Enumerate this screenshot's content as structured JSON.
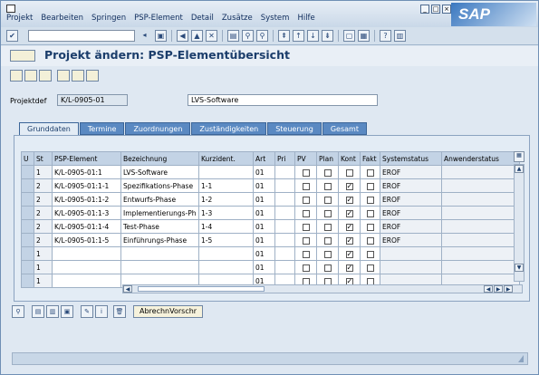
{
  "menu": [
    "Projekt",
    "Bearbeiten",
    "Springen",
    "PSP-Element",
    "Detail",
    "Zusätze",
    "System",
    "Hilfe"
  ],
  "brand": {
    "logo_text": "SAP"
  },
  "title": "Projekt ändern: PSP-Elementübersicht",
  "header": {
    "projektdef_label": "Projektdef",
    "projektdef_value": "K/L-0905-01",
    "projekt_text": "LVS-Software"
  },
  "tabs": [
    "Grunddaten",
    "Termine",
    "Zuordnungen",
    "Zuständigkeiten",
    "Steuerung",
    "Gesamt"
  ],
  "table": {
    "columns": [
      "U",
      "St",
      "PSP-Element",
      "Bezeichnung",
      "Kurzident.",
      "Art",
      "Pri",
      "PV",
      "Plan",
      "Kont",
      "Fakt",
      "Systemstatus",
      "Anwenderstatus"
    ],
    "rows": [
      {
        "st": "1",
        "psp": "K/L-0905-01:1",
        "bez": "LVS-Software",
        "kurz": "",
        "art": "01",
        "pri": "",
        "pv": false,
        "plan": false,
        "kont": false,
        "fakt": false,
        "sys": "EROF",
        "anw": ""
      },
      {
        "st": "2",
        "psp": "K/L-0905-01:1-1",
        "bez": "Spezifikations-Phase",
        "kurz": "1-1",
        "art": "01",
        "pri": "",
        "pv": false,
        "plan": false,
        "kont": true,
        "fakt": false,
        "sys": "EROF",
        "anw": ""
      },
      {
        "st": "2",
        "psp": "K/L-0905-01:1-2",
        "bez": "Entwurfs-Phase",
        "kurz": "1-2",
        "art": "01",
        "pri": "",
        "pv": false,
        "plan": false,
        "kont": true,
        "fakt": false,
        "sys": "EROF",
        "anw": ""
      },
      {
        "st": "2",
        "psp": "K/L-0905-01:1-3",
        "bez": "Implementierungs-Ph",
        "kurz": "1-3",
        "art": "01",
        "pri": "",
        "pv": false,
        "plan": false,
        "kont": true,
        "fakt": false,
        "sys": "EROF",
        "anw": ""
      },
      {
        "st": "2",
        "psp": "K/L-0905-01:1-4",
        "bez": "Test-Phase",
        "kurz": "1-4",
        "art": "01",
        "pri": "",
        "pv": false,
        "plan": false,
        "kont": true,
        "fakt": false,
        "sys": "EROF",
        "anw": ""
      },
      {
        "st": "2",
        "psp": "K/L-0905-01:1-5",
        "bez": "Einführungs-Phase",
        "kurz": "1-5",
        "art": "01",
        "pri": "",
        "pv": false,
        "plan": false,
        "kont": true,
        "fakt": false,
        "sys": "EROF",
        "anw": ""
      },
      {
        "st": "1",
        "psp": "",
        "bez": "",
        "kurz": "",
        "art": "01",
        "pri": "",
        "pv": false,
        "plan": false,
        "kont": true,
        "fakt": false,
        "sys": "",
        "anw": ""
      },
      {
        "st": "1",
        "psp": "",
        "bez": "",
        "kurz": "",
        "art": "01",
        "pri": "",
        "pv": false,
        "plan": false,
        "kont": true,
        "fakt": false,
        "sys": "",
        "anw": ""
      },
      {
        "st": "1",
        "psp": "",
        "bez": "",
        "kurz": "",
        "art": "01",
        "pri": "",
        "pv": false,
        "plan": false,
        "kont": true,
        "fakt": false,
        "sys": "",
        "anw": ""
      }
    ]
  },
  "buttons": {
    "abrechn": "AbrechnVorschr"
  },
  "colors": {
    "tab_blue": "#5a89c2",
    "title_blue": "#1b3d6b",
    "header_cell": "#c3d3e5"
  }
}
